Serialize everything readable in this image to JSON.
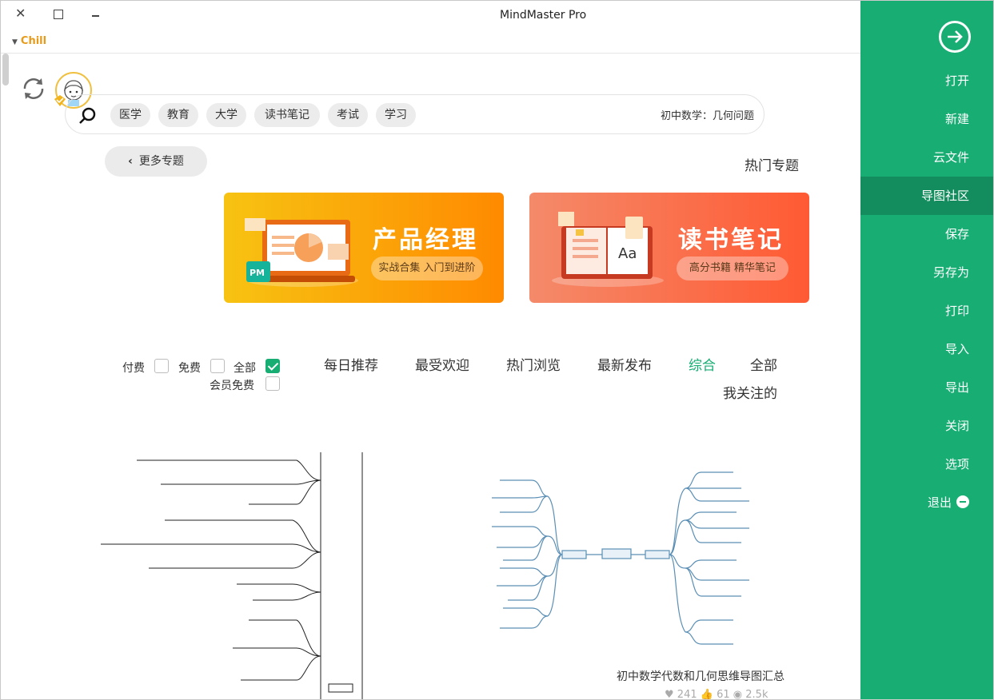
{
  "window": {
    "title": "MindMaster Pro",
    "theme_label": "Chill"
  },
  "sidebar": {
    "items": [
      {
        "label": "打开"
      },
      {
        "label": "新建"
      },
      {
        "label": "云文件"
      },
      {
        "label": "导图社区"
      },
      {
        "label": "保存"
      },
      {
        "label": "另存为"
      },
      {
        "label": "打印"
      },
      {
        "label": "导入"
      },
      {
        "label": "导出"
      },
      {
        "label": "关闭"
      },
      {
        "label": "选项"
      },
      {
        "label": "退出"
      }
    ],
    "active": "导图社区",
    "accent": "#17ad73"
  },
  "search": {
    "placeholder": "初中数学：几何问题",
    "tags": [
      "学习",
      "考试",
      "读书笔记",
      "大学",
      "教育",
      "医学"
    ]
  },
  "section": {
    "title": "热门专题",
    "more_label": "更多专题"
  },
  "banners": [
    {
      "title": "读书笔记",
      "subtitle": "高分书籍 精华笔记",
      "badge": "Aa"
    },
    {
      "title": "产品经理",
      "subtitle": "实战合集 入门到进阶",
      "badge": "PM"
    }
  ],
  "filters": {
    "tabs": [
      "全部",
      "综合",
      "最新发布",
      "热门浏览",
      "最受欢迎",
      "每日推荐",
      "我关注的"
    ],
    "active_tab": "综合",
    "checkboxes": [
      {
        "label": "全部",
        "checked": true
      },
      {
        "label": "免费",
        "checked": false
      },
      {
        "label": "付费",
        "checked": false
      },
      {
        "label": "会员免费",
        "checked": false
      }
    ]
  },
  "cards": [
    {
      "caption": "初中数学代数和几何思维导图汇总",
      "views": "2.5k",
      "likes": "61",
      "favorites": "241"
    }
  ]
}
